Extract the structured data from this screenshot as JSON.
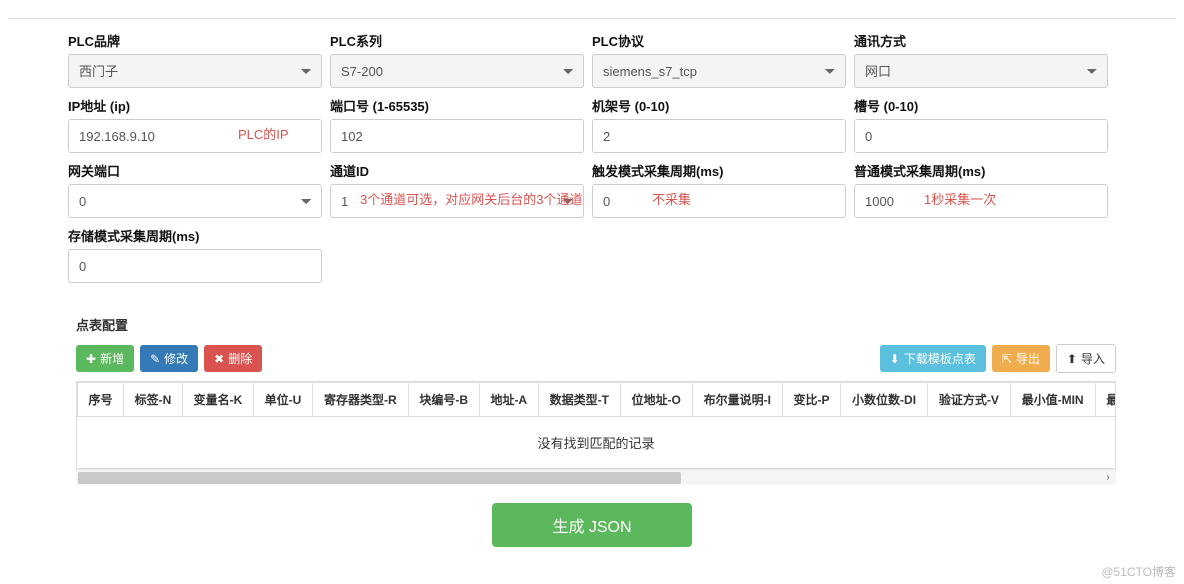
{
  "fields": {
    "plc_brand": {
      "label": "PLC品牌",
      "value": "西门子"
    },
    "plc_series": {
      "label": "PLC系列",
      "value": "S7-200"
    },
    "plc_proto": {
      "label": "PLC协议",
      "value": "siemens_s7_tcp"
    },
    "comm_mode": {
      "label": "通讯方式",
      "value": "网口"
    },
    "ip": {
      "label": "IP地址 (ip)",
      "value": "192.168.9.10"
    },
    "port": {
      "label": "端口号 (1-65535)",
      "value": "102"
    },
    "rack": {
      "label": "机架号 (0-10)",
      "value": "2"
    },
    "slot": {
      "label": "槽号 (0-10)",
      "value": "0"
    },
    "gw_port": {
      "label": "网关端口",
      "value": "0"
    },
    "channel": {
      "label": "通道ID",
      "value": "1"
    },
    "trig_cycle": {
      "label": "触发模式采集周期(ms)",
      "value": "0"
    },
    "norm_cycle": {
      "label": "普通模式采集周期(ms)",
      "value": "1000"
    },
    "store_cycle": {
      "label": "存储模式采集周期(ms)",
      "value": "0"
    }
  },
  "annotations": {
    "ip": "PLC的IP",
    "channel": "3个通道可选，对应网关后台的3个通道",
    "trig": "不采集",
    "norm": "1秒采集一次"
  },
  "section_title": "点表配置",
  "buttons": {
    "add": "新增",
    "edit": "修改",
    "delete": "删除",
    "download_tpl": "下载模板点表",
    "export": "导出",
    "import": "导入"
  },
  "table": {
    "headers": [
      "序号",
      "标签-N",
      "变量名-K",
      "单位-U",
      "寄存器类型-R",
      "块编号-B",
      "地址-A",
      "数据类型-T",
      "位地址-O",
      "布尔量说明-I",
      "变比-P",
      "小数位数-DI",
      "验证方式-V",
      "最小值-MIN",
      "最大值-MA"
    ],
    "no_data": "没有找到匹配的记录"
  },
  "generate_label": "生成 JSON",
  "watermark": "@51CTO博客"
}
